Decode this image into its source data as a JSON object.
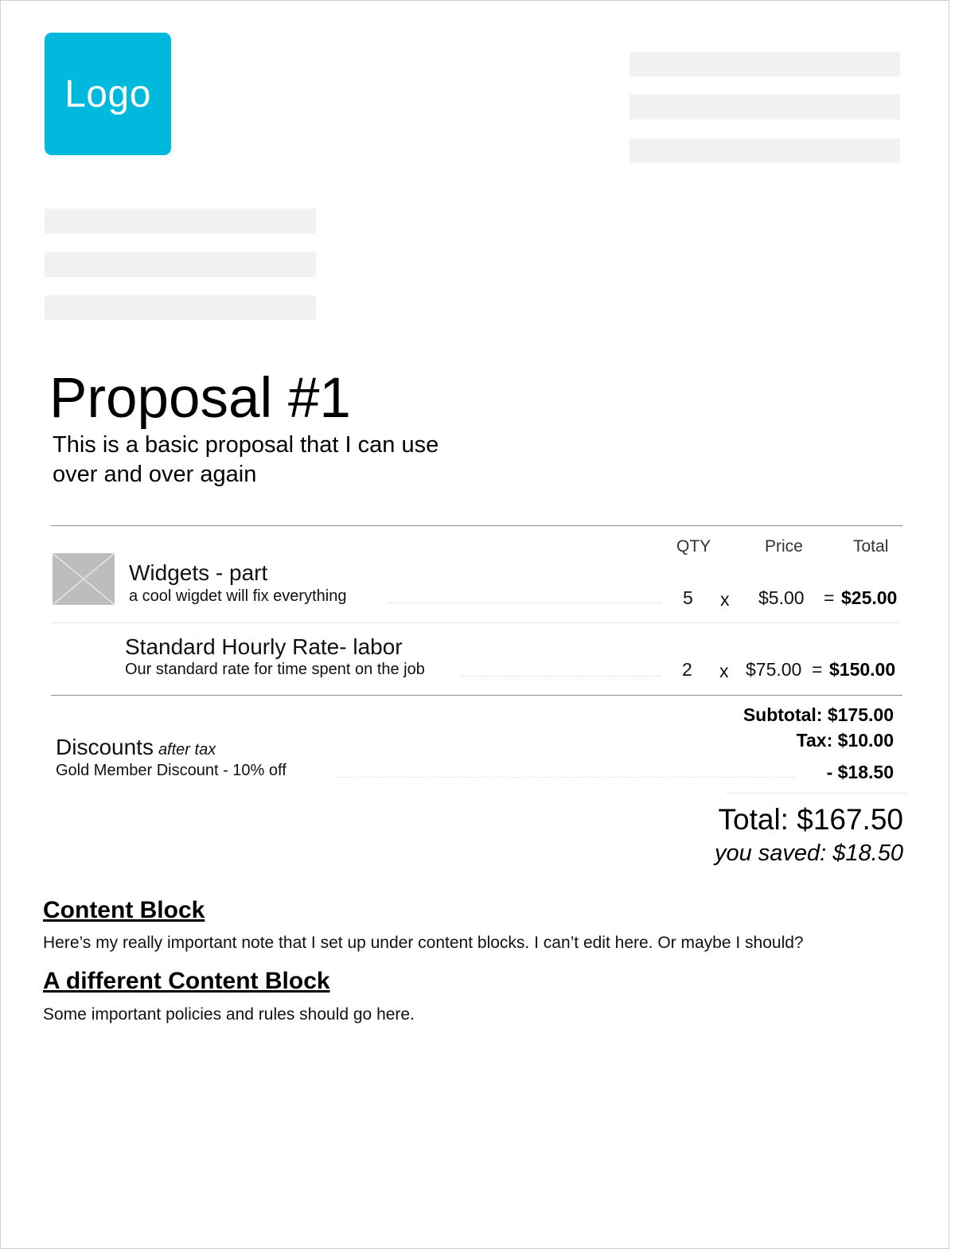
{
  "logo": {
    "label": "Logo",
    "color": "#00b9dc"
  },
  "proposal": {
    "title": "Proposal #1",
    "description_line1": "This is a basic proposal  that I can use",
    "description_line2": "over and over again"
  },
  "table": {
    "headers": {
      "qty": "QTY",
      "price": "Price",
      "total": "Total"
    },
    "items": [
      {
        "name": "Widgets - part",
        "description": "a cool wigdet will fix everything",
        "qty": "5",
        "times": "x",
        "price": "$5.00",
        "equals": "=",
        "total": "$25.00",
        "has_image": true
      },
      {
        "name": "Standard Hourly Rate- labor",
        "description": "Our standard rate for time spent on the job",
        "qty": "2",
        "times": "x",
        "price": "$75.00",
        "equals": "=",
        "total": "$150.00",
        "has_image": false
      }
    ]
  },
  "discounts": {
    "title": "Discounts",
    "note": "after tax",
    "description": "Gold Member Discount - 10% off",
    "amount": "- $18.50"
  },
  "summary": {
    "subtotal": "Subtotal: $175.00",
    "tax": "Tax: $10.00",
    "total": "Total: $167.50",
    "saved": "you saved: $18.50"
  },
  "content_blocks": [
    {
      "heading": "Content Block",
      "body": "Here’s my really important note that I set up under content blocks. I can’t edit here. Or maybe I should?"
    },
    {
      "heading": "A different Content Block",
      "body": "Some important policies and rules should go here."
    }
  ]
}
